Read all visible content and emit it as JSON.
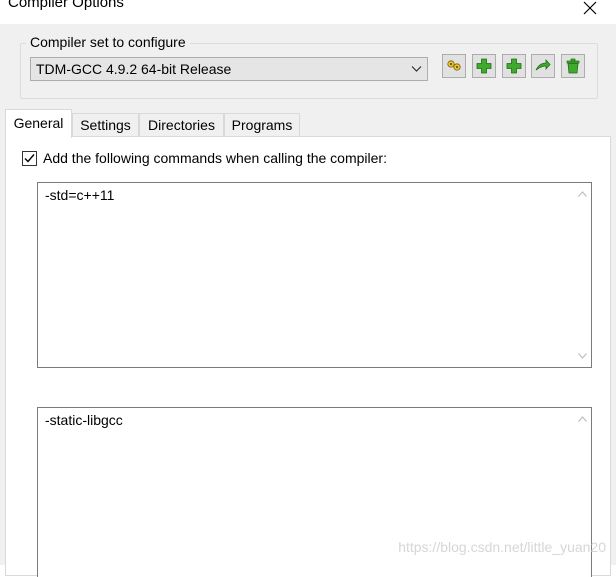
{
  "window": {
    "title": "Compiler Options"
  },
  "compiler_set": {
    "group_label": "Compiler set to configure",
    "selected": "TDM-GCC 4.9.2 64-bit Release",
    "toolbar_icons": [
      "find-compilers-icon",
      "add-blank-icon",
      "add-new-icon",
      "rename-icon",
      "delete-icon"
    ]
  },
  "tabs": [
    {
      "label": "General"
    },
    {
      "label": "Settings"
    },
    {
      "label": "Directories"
    },
    {
      "label": "Programs"
    }
  ],
  "general": {
    "compiler_cmd_checkbox_label": "Add the following commands when calling the compiler:",
    "compiler_cmd_value": "-std=c++11",
    "linker_cmd_value": "-static-libgcc"
  },
  "watermark": "https://blog.csdn.net/little_yuan20",
  "colors": {
    "client_bg": "#f0f0f0",
    "icon_green": "#3faa2e",
    "icon_yellow": "#e8c63c"
  }
}
